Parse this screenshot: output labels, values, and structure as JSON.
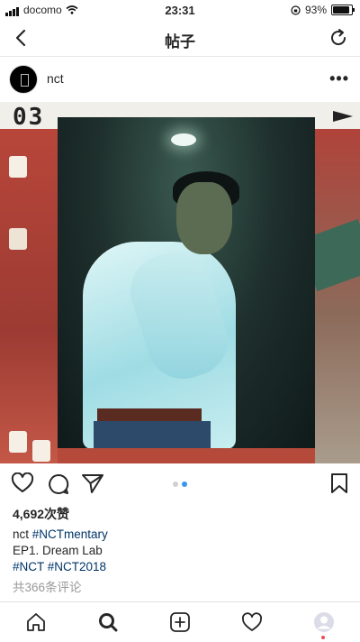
{
  "status_bar": {
    "carrier": "docomo",
    "time": "23:31",
    "battery": "93%"
  },
  "nav": {
    "title": "帖子"
  },
  "post": {
    "username": "nct",
    "likes": "4,692次赞",
    "caption_user": "nct",
    "caption_tag1": "#NCTmentary",
    "caption_line2": "EP1. Dream Lab",
    "caption_tag2": "#NCT",
    "caption_tag3": "#NCT2018",
    "comments_link": "共366条评论",
    "photo_label": "03",
    "carousel": {
      "count": 2,
      "active": 2
    }
  },
  "colors": {
    "tag": "#003569",
    "active_dot": "#3897f0",
    "notification": "#ed4956"
  },
  "icons": [
    "back-icon",
    "refresh-icon",
    "more-icon",
    "heart-icon",
    "comment-icon",
    "share-icon",
    "bookmark-icon",
    "home-icon",
    "search-icon",
    "add-icon",
    "activity-icon",
    "profile-icon"
  ]
}
